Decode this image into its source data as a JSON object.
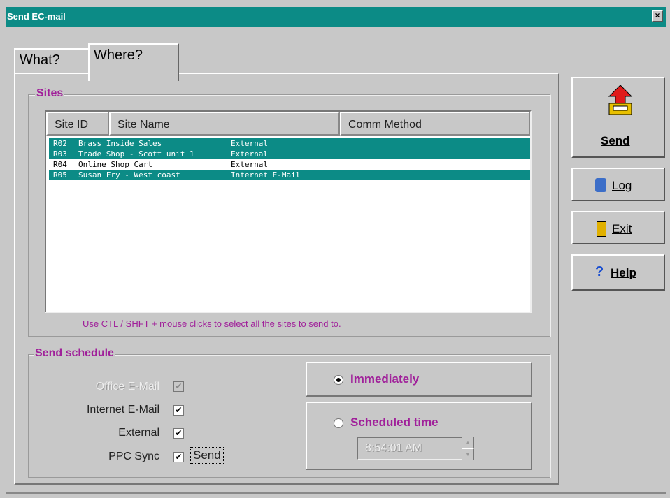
{
  "window": {
    "title": "Send EC-mail",
    "close_glyph": "×"
  },
  "tabs": [
    {
      "label": "What?",
      "active": false
    },
    {
      "label": "Where?",
      "active": true
    }
  ],
  "sites": {
    "group_label": "Sites",
    "columns": [
      "Site ID",
      "Site Name",
      "Comm Method"
    ],
    "rows": [
      {
        "id": "R02",
        "name": "Brass Inside Sales",
        "method": "External",
        "selected": true
      },
      {
        "id": "R03",
        "name": "Trade Shop - Scott unit 1",
        "method": "External",
        "selected": true
      },
      {
        "id": "R04",
        "name": "Online Shop Cart",
        "method": "External",
        "selected": false
      },
      {
        "id": "R05",
        "name": "Susan Fry - West coast",
        "method": "Internet E-Mail",
        "selected": true
      }
    ],
    "hint": "Use CTL / SHFT + mouse clicks to select all the sites to send to."
  },
  "schedule": {
    "group_label": "Send schedule",
    "options": [
      {
        "label": "Office E-Mail",
        "checked": true,
        "enabled": false
      },
      {
        "label": "Internet E-Mail",
        "checked": true,
        "enabled": true
      },
      {
        "label": "External",
        "checked": true,
        "enabled": true
      },
      {
        "label": "PPC Sync",
        "checked": true,
        "enabled": true
      }
    ],
    "ppc_send_label": "Send",
    "immediately_label": "Immediately",
    "scheduled_label": "Scheduled time",
    "time_value": "8:54:01 AM",
    "selected": "immediately"
  },
  "buttons": {
    "send": "Send",
    "log": "Log",
    "exit": "Exit",
    "help": "Help"
  },
  "colors": {
    "selection": "#0c8b86",
    "accent_text": "#a0209a"
  }
}
